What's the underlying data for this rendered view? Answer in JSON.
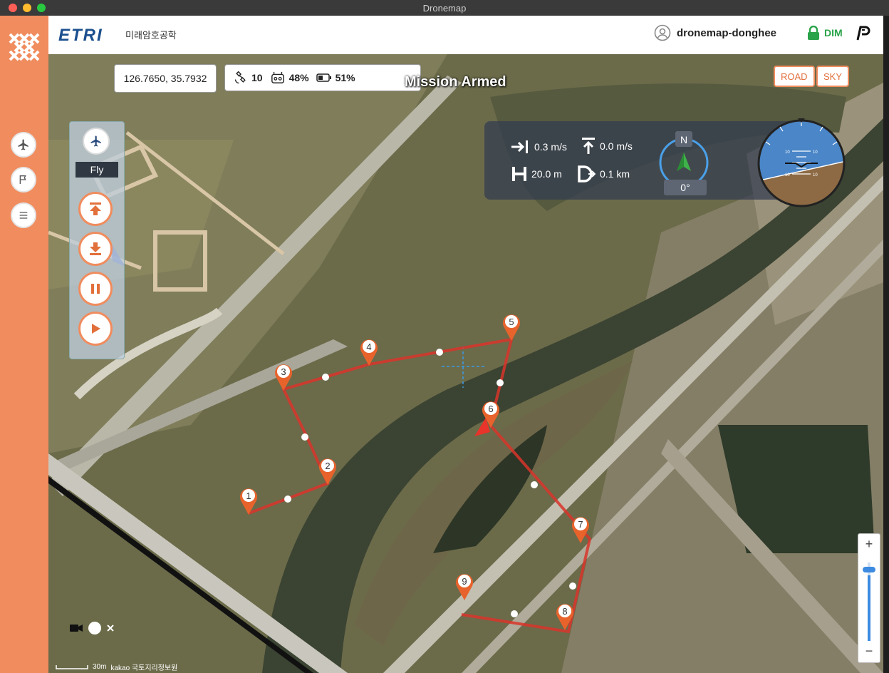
{
  "window": {
    "title": "Dronemap"
  },
  "header": {
    "brand": "ETRI",
    "brand_sub": "미래암호공학",
    "username": "dronemap-donghee",
    "dim_label": "DIM"
  },
  "sidebar": {
    "items": [
      {
        "name": "airplane",
        "icon": "airplane-icon"
      },
      {
        "name": "flag",
        "icon": "flag-icon"
      },
      {
        "name": "menu",
        "icon": "menu-icon"
      }
    ]
  },
  "map": {
    "coordinates": "126.7650, 35.7932",
    "satellites": "10",
    "controller_battery": "48%",
    "drone_battery": "51%",
    "mission_status": "Mission Armed",
    "map_types": [
      "ROAD",
      "SKY"
    ],
    "fly_label": "Fly",
    "fly_controls": [
      "takeoff",
      "land",
      "pause",
      "play"
    ],
    "telemetry": {
      "horizontal_speed": "0.3 m/s",
      "vertical_speed": "0.0 m/s",
      "height": "20.0 m",
      "distance": "0.1 km",
      "compass_north": "N",
      "heading": "0°"
    },
    "attitude_scale": [
      "10",
      "10",
      "10",
      "10"
    ],
    "waypoints": [
      "1",
      "2",
      "3",
      "4",
      "5",
      "6",
      "7",
      "8",
      "9"
    ],
    "zoom": {
      "plus": "+",
      "minus": "−"
    },
    "scale_label": "30m",
    "attribution": "kakao  국토지리정보원"
  },
  "colors": {
    "accent": "#f08c5e",
    "route": "#e23b2e",
    "brand": "#1b4f8f",
    "lock": "#2aa34a"
  }
}
